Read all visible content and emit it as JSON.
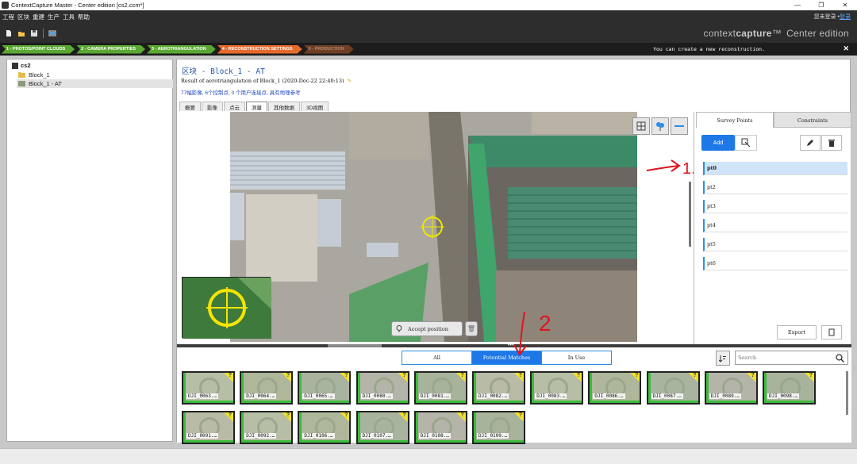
{
  "window": {
    "title": "ContextCapture Master - Center edition [cs2.ccm*]",
    "controls": [
      "—",
      "❐",
      "✕"
    ]
  },
  "menu": {
    "items": [
      "工程",
      "区块",
      "重建",
      "生产",
      "工具",
      "帮助"
    ],
    "login_text": "您未登录 •",
    "login_link": "登录"
  },
  "brand": {
    "light": "context",
    "bold": "capture",
    "tm": "™",
    "edition": "Center edition"
  },
  "steps": [
    {
      "label": "1 - PHOTOS/POINT CLOUDS",
      "state": "done"
    },
    {
      "label": "2 - CAMERA PROPERTIES",
      "state": "done"
    },
    {
      "label": "3 - AEROTRIANGULATION",
      "state": "done"
    },
    {
      "label": "4 - RECONSTRUCTION SETTINGS",
      "state": "active"
    },
    {
      "label": "5 - PRODUCTION",
      "state": "next"
    }
  ],
  "step_message": "You can create a new reconstruction.",
  "step_close": "✕",
  "tree": {
    "root": "cs2",
    "items": [
      "Block_1",
      "Block_1 - AT"
    ]
  },
  "block": {
    "title": "区块 - Block_1 - AT",
    "result": "Result of aerotriangulation of Block_1 (2020-Dec-22 22:40:13)",
    "stats": "77幅影像, 6个控制点, 0 个用户连接点, 具有地理参考"
  },
  "subtabs": [
    "概要",
    "影像",
    "点云",
    "测量",
    "其他数据",
    "3D视图"
  ],
  "viewer": {
    "accept_label": "Accept position"
  },
  "survey": {
    "tabs": [
      "Survey Points",
      "Constraints"
    ],
    "add_label": "Add",
    "points": [
      "pt0",
      "pt2",
      "pt3",
      "pt4",
      "pt5",
      "pt6"
    ],
    "export_label": "Export"
  },
  "filters": [
    "All",
    "Potential Matches",
    "In Use"
  ],
  "search": {
    "placeholder": "Search"
  },
  "thumbnails": [
    "DJI_0063.…",
    "DJI_0064.…",
    "DJI_0065.…",
    "DJI_0080.…",
    "DJI_0081.…",
    "DJI_0082.…",
    "DJI_0083.…",
    "DJI_0086.…",
    "DJI_0087.…",
    "DJI_0089.…",
    "DJI_0098.…",
    "DJI_0091.…",
    "DJI_0092.…",
    "DJI_0106.…",
    "DJI_0107.…",
    "DJI_0108.…",
    "DJI_0109.…"
  ],
  "annotations": {
    "arrow1": "1.",
    "arrow2": "2"
  },
  "colors": {
    "accent": "#1e78e8",
    "done_step": "#5aa832",
    "active_step": "#e66a2c",
    "annotation": "#e0141e"
  }
}
